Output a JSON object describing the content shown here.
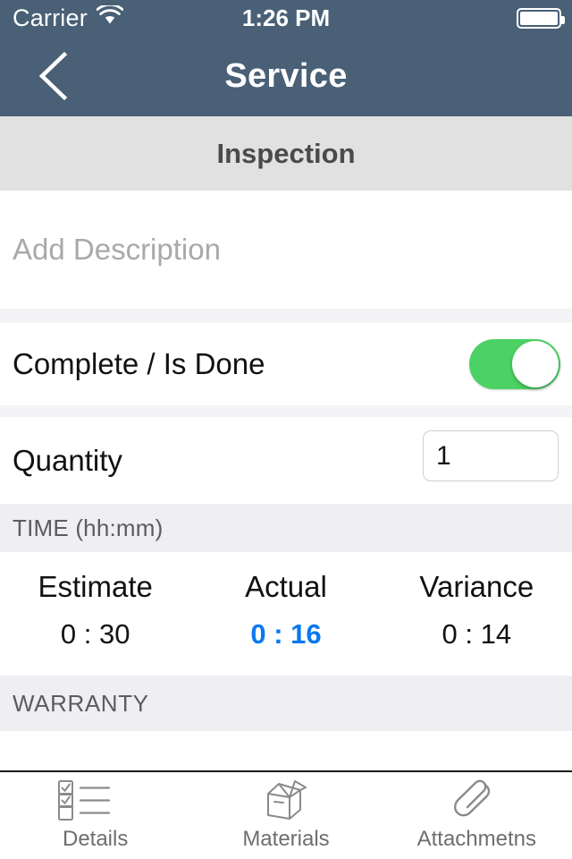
{
  "status_bar": {
    "carrier": "Carrier",
    "wifi_icon": "wifi-icon",
    "time": "1:26 PM",
    "battery_icon": "battery-full-icon"
  },
  "nav_bar": {
    "back_icon": "chevron-left-icon",
    "title": "Service"
  },
  "section_header": {
    "title": "Inspection"
  },
  "description": {
    "placeholder": "Add Description",
    "value": ""
  },
  "complete": {
    "label": "Complete / Is Done",
    "toggle_state": "on",
    "toggle_color": "#4cd264"
  },
  "quantity": {
    "label": "Quantity",
    "value": "1"
  },
  "time_section": {
    "header": "TIME (hh:mm)",
    "columns": [
      {
        "label": "Estimate",
        "value": "0 : 30",
        "color": "#111111"
      },
      {
        "label": "Actual",
        "value": "0 : 16",
        "color": "#0a78f0"
      },
      {
        "label": "Variance",
        "value": "0 : 14",
        "color": "#111111"
      }
    ]
  },
  "warranty_section": {
    "header": "WARRANTY"
  },
  "tab_bar": {
    "tabs": [
      {
        "label": "Details",
        "icon": "checklist-icon"
      },
      {
        "label": "Materials",
        "icon": "open-box-icon"
      },
      {
        "label": "Attachmetns",
        "icon": "paperclip-icon"
      }
    ]
  },
  "theme": {
    "navbar_color": "#496076",
    "accent_blue": "#0a78f0",
    "toggle_green": "#4cd264"
  }
}
